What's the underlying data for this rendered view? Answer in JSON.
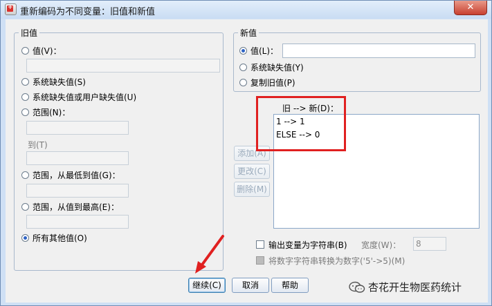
{
  "window": {
    "title": "重新编码为不同变量：旧值和新值",
    "close_glyph": "✕"
  },
  "old_value": {
    "legend": "旧值",
    "options": {
      "value": "值(V)：",
      "system_missing": "系统缺失值(S)",
      "system_or_user_missing": "系统缺失值或用户缺失值(U)",
      "range": "范围(N)：",
      "range_to": "到(T)",
      "range_lowest": "范围，从最低到值(G)：",
      "range_highest": "范围，从值到最高(E)：",
      "all_other": "所有其他值(O)"
    },
    "selected": "all_other"
  },
  "new_value": {
    "legend": "新值",
    "options": {
      "value": "值(L)：",
      "system_missing": "系统缺失值(Y)",
      "copy_old": "复制旧值(P)"
    },
    "selected": "value",
    "value_input": ""
  },
  "mapping": {
    "label": "旧 --> 新(D)：",
    "items": [
      "1 --> 1",
      "ELSE --> 0"
    ]
  },
  "action_buttons": {
    "add": "添加(A)",
    "change": "更改(C)",
    "remove": "删除(M)"
  },
  "output_options": {
    "string_output": "输出变量为字符串(B)",
    "width_label": "宽度(W)：",
    "width_value": "8",
    "convert_numeric": "将数字字符串转换为数字('5'->5)(M)"
  },
  "footer": {
    "continue": "继续(C)",
    "cancel": "取消",
    "help": "帮助"
  },
  "watermark": {
    "text": "杏花开生物医药统计"
  },
  "colors": {
    "highlight_box": "#e02020",
    "radio_dot": "#2d62c5"
  }
}
